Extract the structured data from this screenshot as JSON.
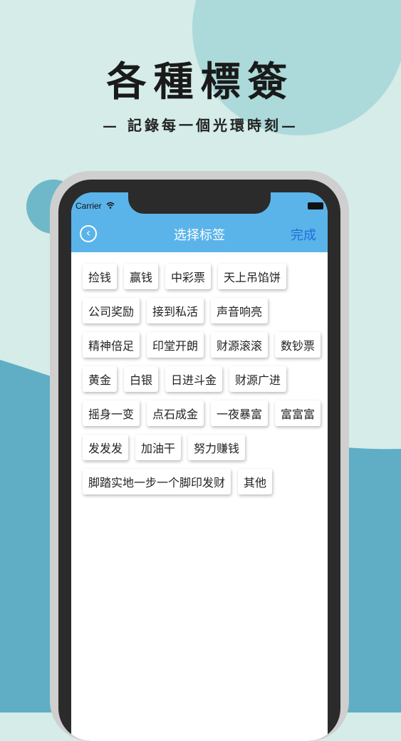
{
  "hero": {
    "title": "各種標簽",
    "subtitle": "— 記錄每一個光環時刻—"
  },
  "status_bar": {
    "carrier": "Carrier",
    "wifi_icon": "wifi-icon",
    "battery_icon": "battery-icon"
  },
  "nav": {
    "back_icon": "chevron-left-icon",
    "back_glyph": "‹",
    "title": "选择标签",
    "done_label": "完成"
  },
  "colors": {
    "navbar": "#5ab4ea",
    "done": "#1e6fd6",
    "background_light": "#d5ece8",
    "background_teal": "#5faec6"
  },
  "tag_rows": [
    [
      "捡钱",
      "赢钱",
      "中彩票",
      "天上吊馅饼"
    ],
    [
      "公司奖励",
      "接到私活",
      "声音响亮"
    ],
    [
      "精神倍足",
      "印堂开朗",
      "财源滚滚",
      "数钞票"
    ],
    [
      "黄金",
      "白银",
      "日进斗金",
      "财源广进"
    ],
    [
      "摇身一变",
      "点石成金",
      "一夜暴富",
      "富富富"
    ],
    [
      "发发发",
      "加油干",
      "努力赚钱"
    ],
    [
      "脚踏实地一步一个脚印发财",
      "其他"
    ]
  ]
}
